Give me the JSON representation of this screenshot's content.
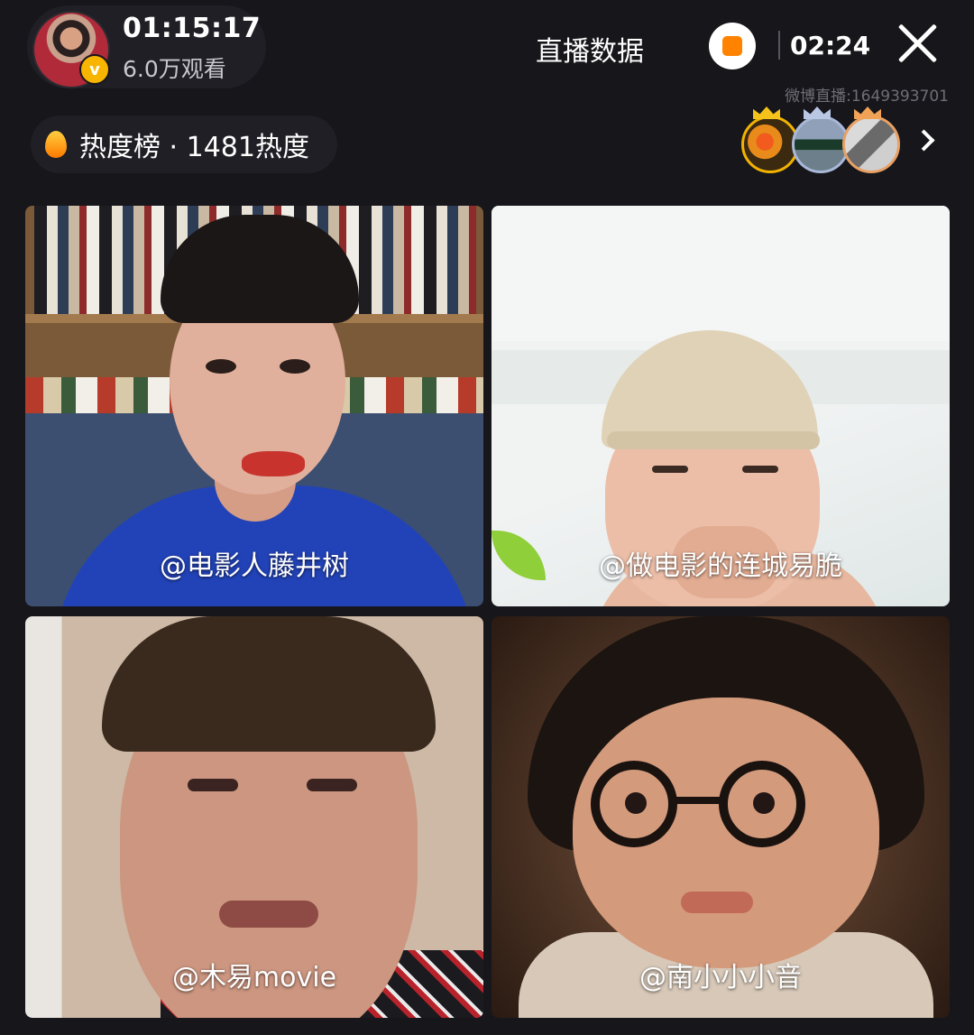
{
  "header": {
    "elapsed_time": "01:15:17",
    "viewers": "6.0万观看",
    "live_data_label": "直播数据",
    "duration": "02:24",
    "room_id": "微博直播:1649393701"
  },
  "heat": {
    "label": "热度榜 · 1481热度"
  },
  "colors": {
    "accent_orange": "#ff8200",
    "verify_gold": "#f7b500",
    "background": "#16161b"
  },
  "icons": {
    "record": "stop-record-icon",
    "close": "close-icon",
    "flame": "flame-icon",
    "arrow": "chevron-right-icon",
    "verified": "verified-badge-icon"
  },
  "participants": [
    {
      "label": "@电影人藤井树"
    },
    {
      "label": "@做电影的连城易脆"
    },
    {
      "label": "@木易movie"
    },
    {
      "label": "@南小小小音"
    }
  ]
}
